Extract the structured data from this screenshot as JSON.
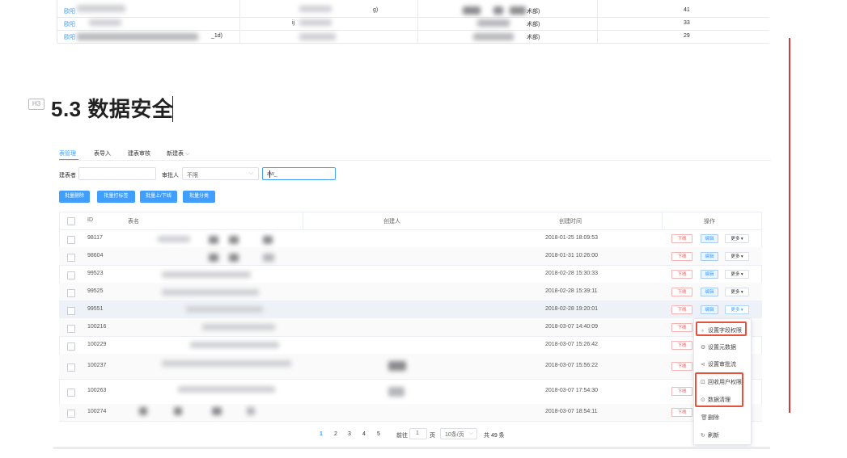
{
  "top_table": {
    "rows": [
      {
        "link": "欧阳",
        "mid": "g)",
        "dept": "术部)",
        "count": "41"
      },
      {
        "link": "欧阳",
        "mid": "ij",
        "dept": "术部)",
        "count": "33"
      },
      {
        "link": "欧阳",
        "mid": "_1d)",
        "dept": "术部)",
        "count": "29"
      }
    ]
  },
  "heading": {
    "icon": "H3",
    "title": "5.3 数据安全"
  },
  "tabs": [
    {
      "label": "表管理",
      "active": true
    },
    {
      "label": "表导入",
      "active": false
    },
    {
      "label": "建表审核",
      "active": false
    },
    {
      "label": "新建表",
      "active": false,
      "chevron": "⌵"
    }
  ],
  "filters": {
    "creator_label": "建表者",
    "creator_value": "",
    "approver_label": "审批人",
    "approver_value": "不限",
    "search_value": "aw_"
  },
  "batch_buttons": [
    "批量删除",
    "批量打标签",
    "批量上/下线",
    "批量分类"
  ],
  "table": {
    "headers": {
      "id": "ID",
      "name": "表名",
      "creator": "创建人",
      "created": "创建时间",
      "action": "操作"
    },
    "action_labels": {
      "offline": "下线",
      "edit": "编辑",
      "more": "更多 ▾"
    },
    "rows": [
      {
        "id": "98117",
        "created": "2018-01-25 18:09:53"
      },
      {
        "id": "98604",
        "created": "2018-01-31 10:26:00"
      },
      {
        "id": "99523",
        "created": "2018-02-28 15:30:33"
      },
      {
        "id": "99525",
        "created": "2018-02-28 15:39:11"
      },
      {
        "id": "99551",
        "created": "2018-02-28 19:20:01"
      },
      {
        "id": "100216",
        "created": "2018-03-07 14:40:09"
      },
      {
        "id": "100229",
        "created": "2018-03-07 15:26:42"
      },
      {
        "id": "100237",
        "created": "2018-03-07 15:56:22"
      },
      {
        "id": "100263",
        "created": "2018-03-07 17:54:30"
      },
      {
        "id": "100274",
        "created": "2018-03-07 18:54:11"
      }
    ]
  },
  "dropdown": {
    "items": [
      {
        "icon": "lock-icon",
        "glyph": "♁",
        "label": "设置字段权限"
      },
      {
        "icon": "gear-icon",
        "glyph": "⚙",
        "label": "设置元数据"
      },
      {
        "icon": "share-icon",
        "glyph": "⋖",
        "label": "设置审批流"
      },
      {
        "icon": "user-lock-icon",
        "glyph": "⊡",
        "label": "回收用户权限"
      },
      {
        "icon": "clean-icon",
        "glyph": "⊙",
        "label": "数据清理"
      },
      {
        "icon": "trash-icon",
        "glyph": "🗑",
        "label": "删除"
      },
      {
        "icon": "refresh-icon",
        "glyph": "↻",
        "label": "刷新"
      }
    ]
  },
  "pagination": {
    "pages": [
      "1",
      "2",
      "3",
      "4",
      "5"
    ],
    "current": "1",
    "goto_label": "前往",
    "goto_value": "1",
    "page_unit": "页",
    "page_size": "10条/页",
    "total": "共 49 条"
  },
  "colors": {
    "primary": "#409eff",
    "danger": "#e05a5a",
    "highlight": "#e5523e"
  }
}
